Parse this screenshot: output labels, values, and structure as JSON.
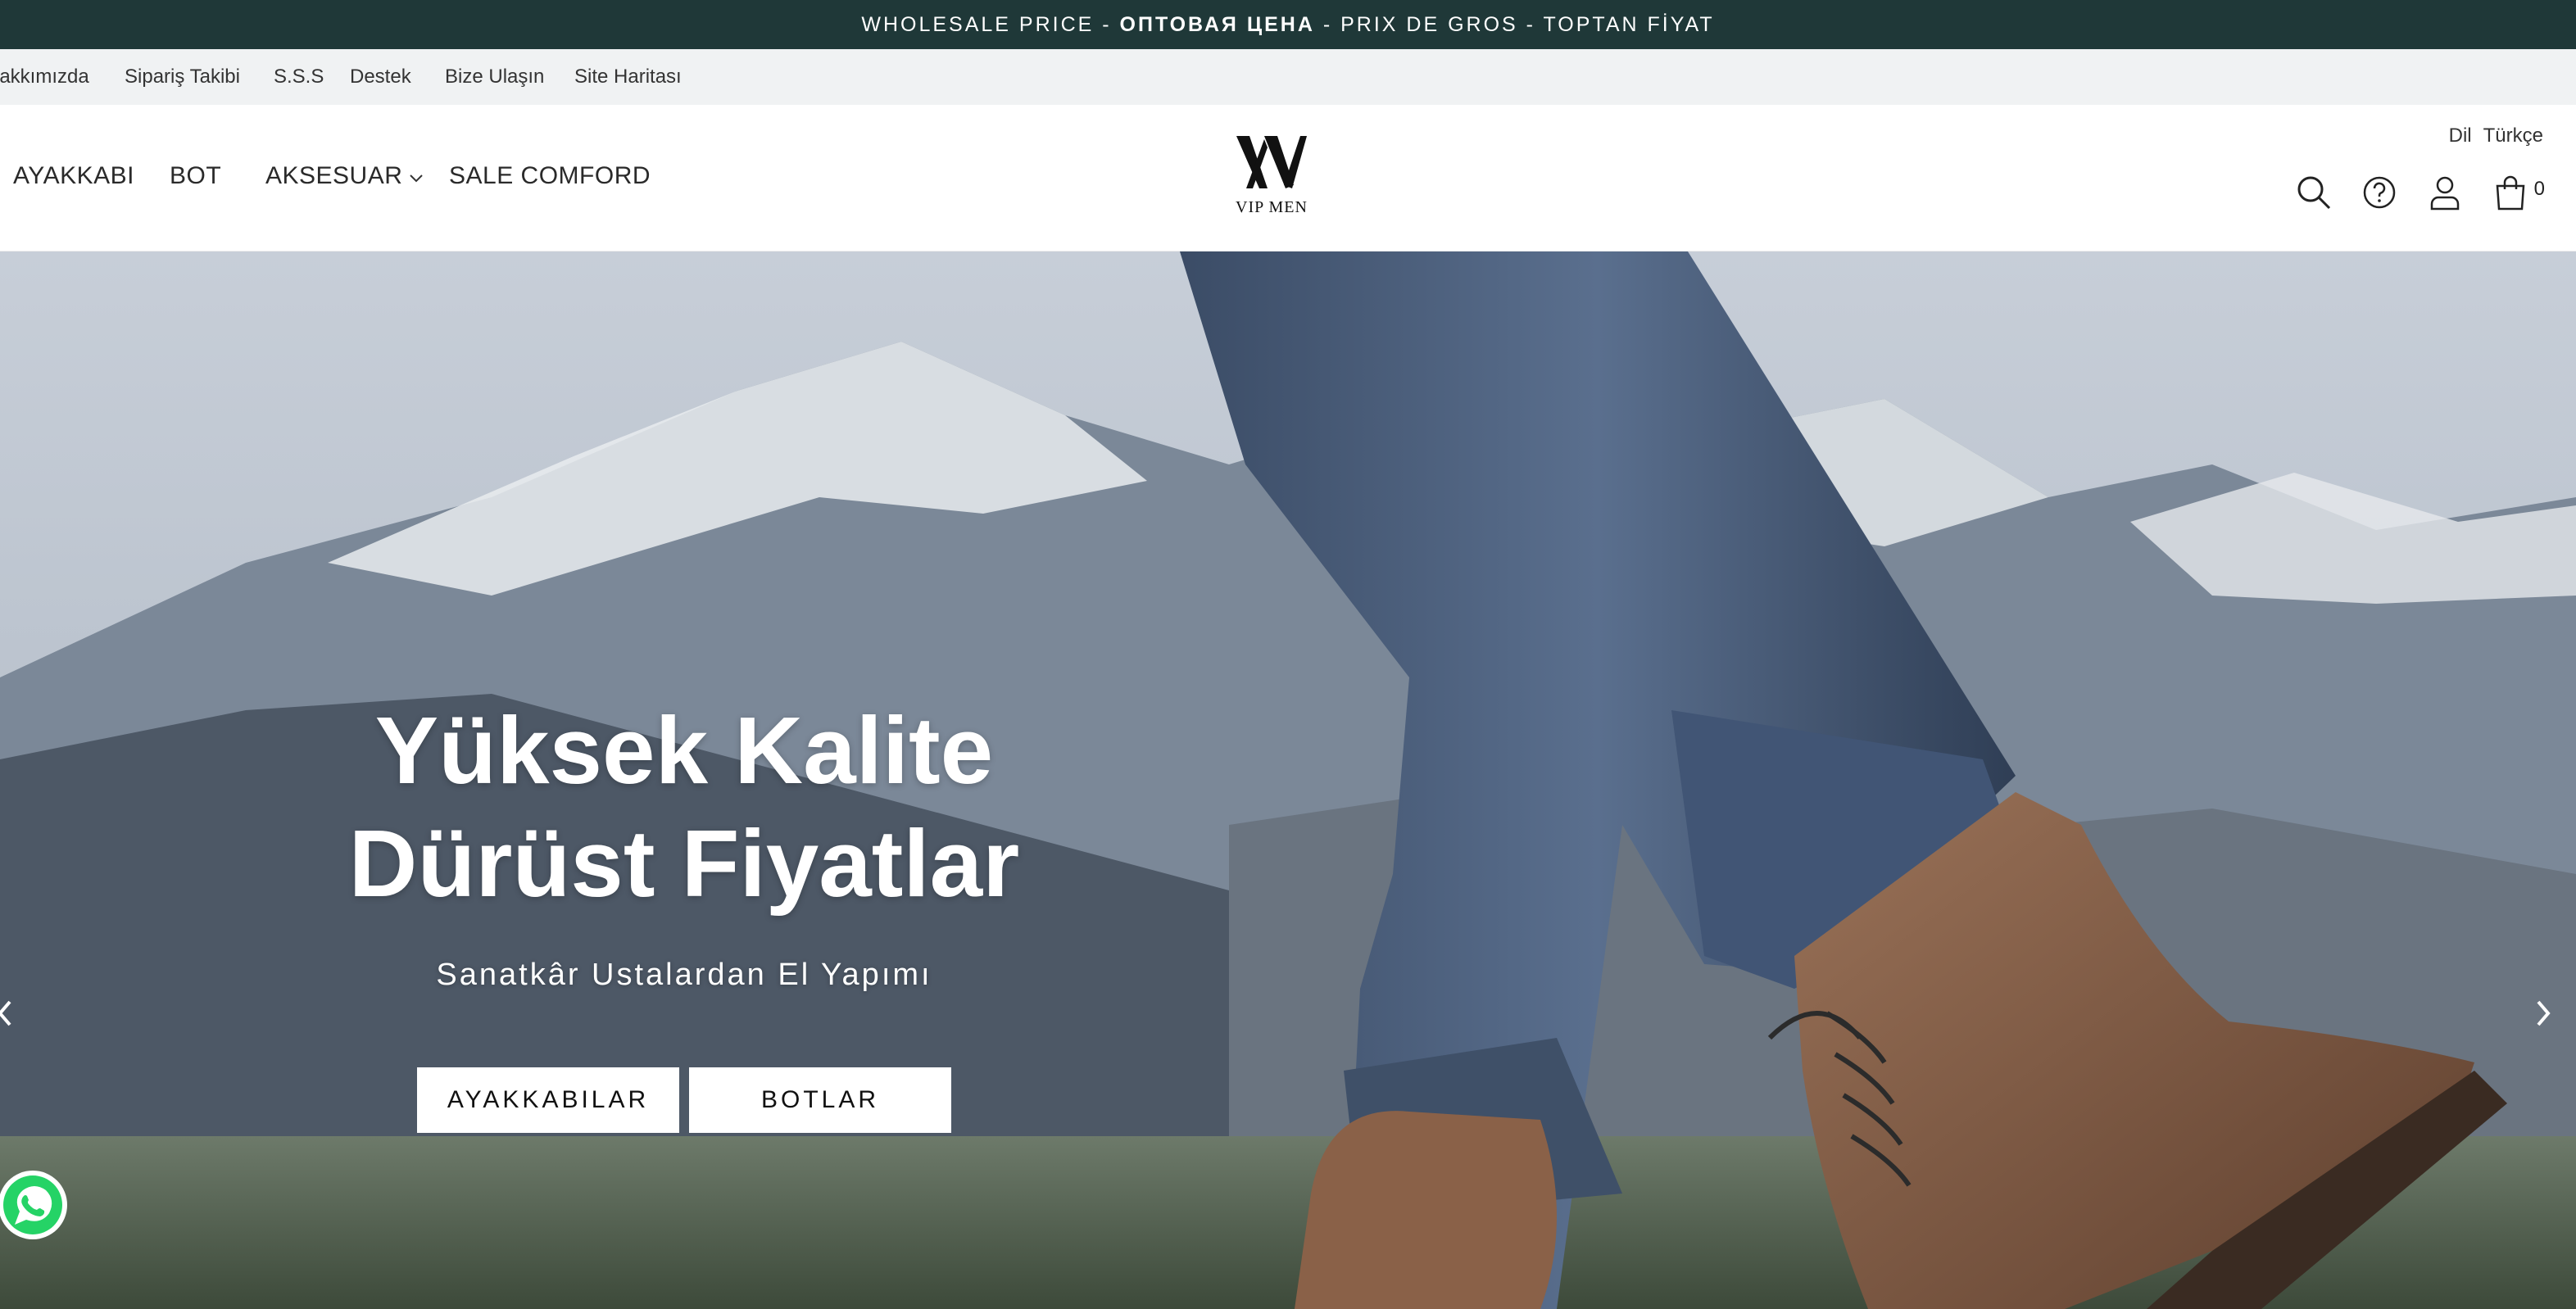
{
  "announcement": {
    "text": "WHOLESALE PRICE - ",
    "bold": "ОПТОВАЯ ЦЕНА",
    "text2": " - PRIX DE GROS - TOPTAN FİYAT"
  },
  "sublinks": [
    "Hakkımızda",
    "Sipariş Takibi",
    "S.S.S",
    "Destek",
    "Bize Ulaşın",
    "Site Haritası"
  ],
  "nav": {
    "items": [
      "AYAKKABI",
      "BOT",
      "AKSESUAR",
      "SALE COMFORD"
    ]
  },
  "logo": {
    "brand": "VIP MEN"
  },
  "language": {
    "label": "Dil",
    "value": "Türkçe"
  },
  "cart": {
    "count": "0"
  },
  "hero": {
    "title_line1": "Yüksek Kalite",
    "title_line2": "Dürüst Fiyatlar",
    "subtitle": "Sanatkâr Ustalardan El Yapımı",
    "button1": "AYAKKABILAR",
    "button2": "BOTLAR"
  },
  "colors": {
    "announcement_bg": "#1f3838",
    "sublinks_bg": "#f0f2f3",
    "whatsapp": "#25d366"
  },
  "icons": [
    "search-icon",
    "help-icon",
    "user-icon",
    "cart-icon",
    "chevron-left-icon",
    "chevron-right-icon",
    "whatsapp-icon",
    "chevron-down-icon"
  ]
}
